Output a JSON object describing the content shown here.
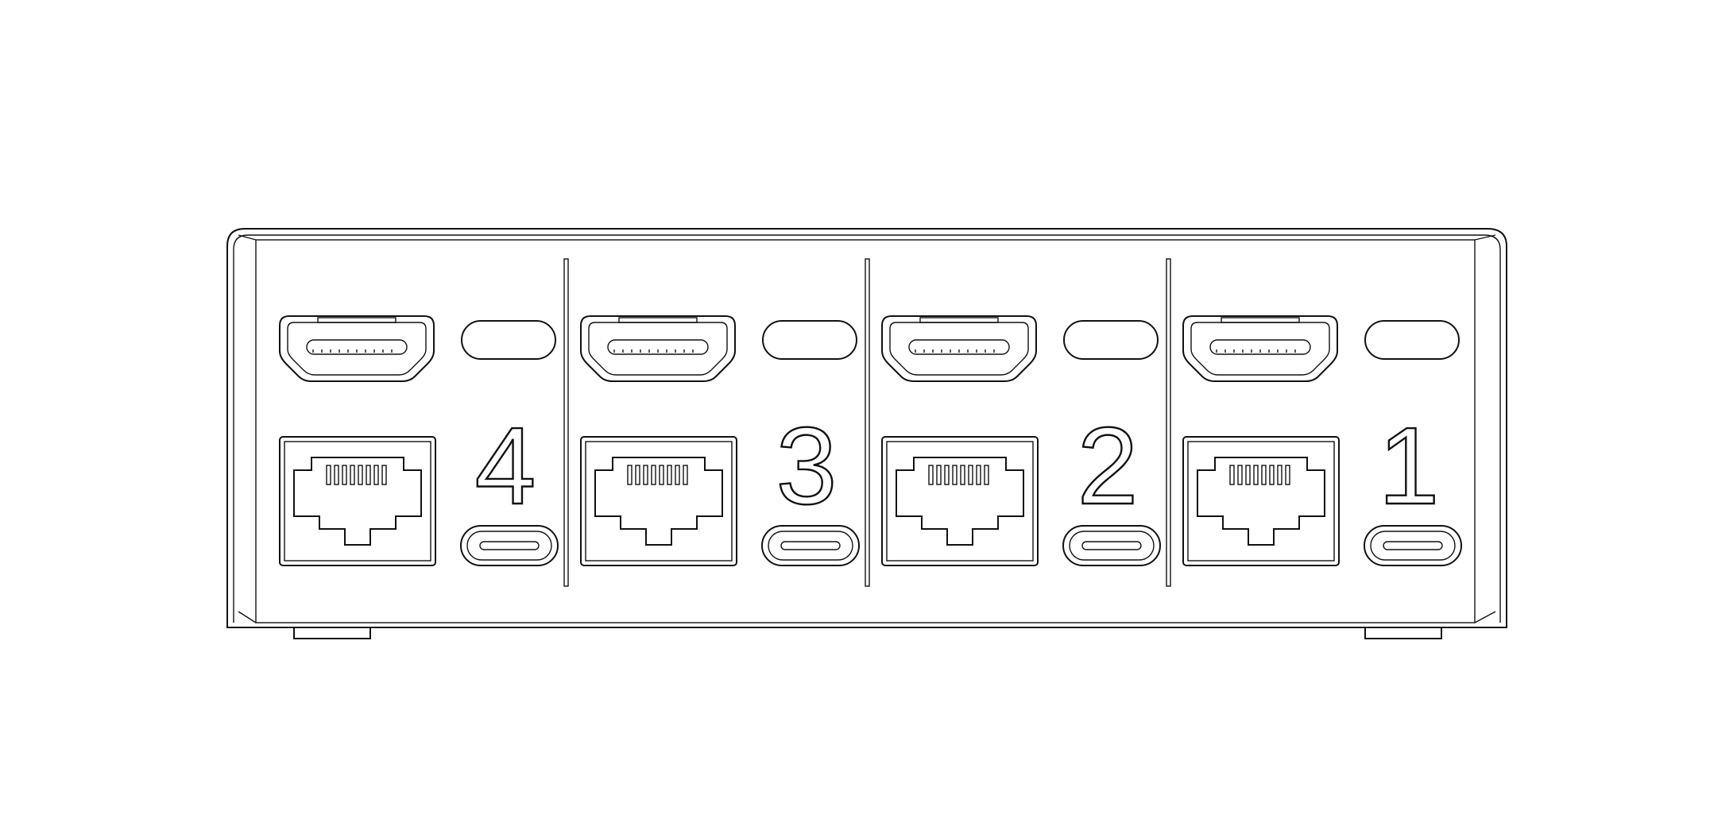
{
  "device": {
    "ports": [
      {
        "number": "4"
      },
      {
        "number": "3"
      },
      {
        "number": "2"
      },
      {
        "number": "1"
      }
    ]
  }
}
